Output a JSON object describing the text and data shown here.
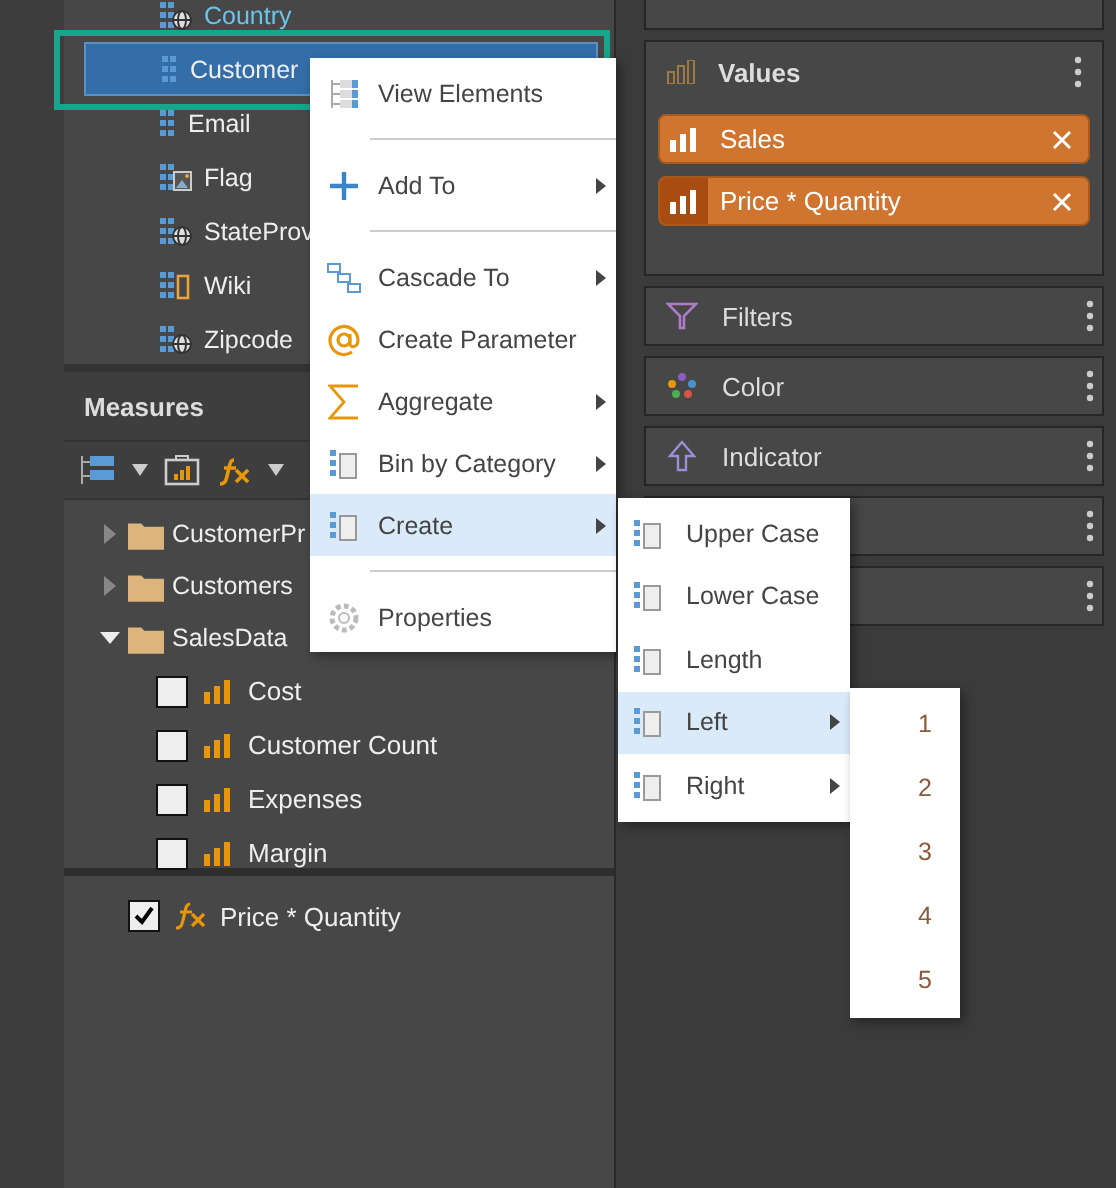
{
  "dimensions": {
    "items": [
      {
        "label": "Country",
        "kind": "geo",
        "selected": false,
        "linked": true
      },
      {
        "label": "Customer",
        "kind": "dimension",
        "selected": true,
        "linked": false
      },
      {
        "label": "Email",
        "kind": "dimension",
        "selected": false,
        "linked": false
      },
      {
        "label": "Flag",
        "kind": "image",
        "selected": false,
        "linked": false
      },
      {
        "label": "StateProv",
        "kind": "geo",
        "selected": false,
        "linked": false
      },
      {
        "label": "Wiki",
        "kind": "link",
        "selected": false,
        "linked": false
      },
      {
        "label": "Zipcode",
        "kind": "geo",
        "selected": false,
        "linked": false
      }
    ]
  },
  "measures": {
    "title": "Measures",
    "tree": [
      {
        "label": "CustomerPr",
        "expanded": false
      },
      {
        "label": "Customers",
        "expanded": false
      },
      {
        "label": "SalesData",
        "expanded": true,
        "children": [
          {
            "label": "Cost",
            "checked": false
          },
          {
            "label": "Customer Count",
            "checked": false
          },
          {
            "label": "Expenses",
            "checked": false
          },
          {
            "label": "Margin",
            "checked": false
          }
        ]
      }
    ]
  },
  "calculated": [
    {
      "label": "Price * Quantity",
      "checked": true
    }
  ],
  "values": {
    "title": "Values",
    "chips": [
      {
        "label": "Sales",
        "highlighted": false
      },
      {
        "label": "Price * Quantity",
        "highlighted": true
      }
    ]
  },
  "panels": [
    {
      "title": "Filters",
      "kind": "filter"
    },
    {
      "title": "Color",
      "kind": "color"
    },
    {
      "title": "Indicator",
      "kind": "indicator"
    },
    {
      "kind": "blank"
    },
    {
      "kind": "blank"
    }
  ],
  "context_menu": {
    "items": [
      {
        "kind": "tree",
        "label": "View Elements",
        "submenu": false,
        "selected": false
      },
      {
        "kind": "separator"
      },
      {
        "kind": "plus",
        "label": "Add To",
        "submenu": true,
        "selected": false
      },
      {
        "kind": "separator"
      },
      {
        "kind": "cascade",
        "label": "Cascade To",
        "submenu": true,
        "selected": false
      },
      {
        "kind": "at",
        "label": "Create Parameter",
        "submenu": false,
        "selected": false
      },
      {
        "kind": "sigma",
        "label": "Aggregate",
        "submenu": true,
        "selected": false
      },
      {
        "kind": "column",
        "label": "Bin by Category",
        "submenu": true,
        "selected": false
      },
      {
        "kind": "column",
        "label": "Create",
        "submenu": true,
        "selected": true
      },
      {
        "kind": "separator"
      },
      {
        "kind": "gear",
        "label": "Properties",
        "submenu": false,
        "selected": false
      }
    ]
  },
  "create_submenu": {
    "items": [
      {
        "label": "Upper Case",
        "submenu": false,
        "selected": false
      },
      {
        "label": "Lower Case",
        "submenu": false,
        "selected": false
      },
      {
        "label": "Length",
        "submenu": false,
        "selected": false
      },
      {
        "label": "Left",
        "submenu": true,
        "selected": true
      },
      {
        "label": "Right",
        "submenu": true,
        "selected": false
      }
    ]
  },
  "left_submenu": {
    "items": [
      "1",
      "2",
      "3",
      "4",
      "5"
    ]
  }
}
